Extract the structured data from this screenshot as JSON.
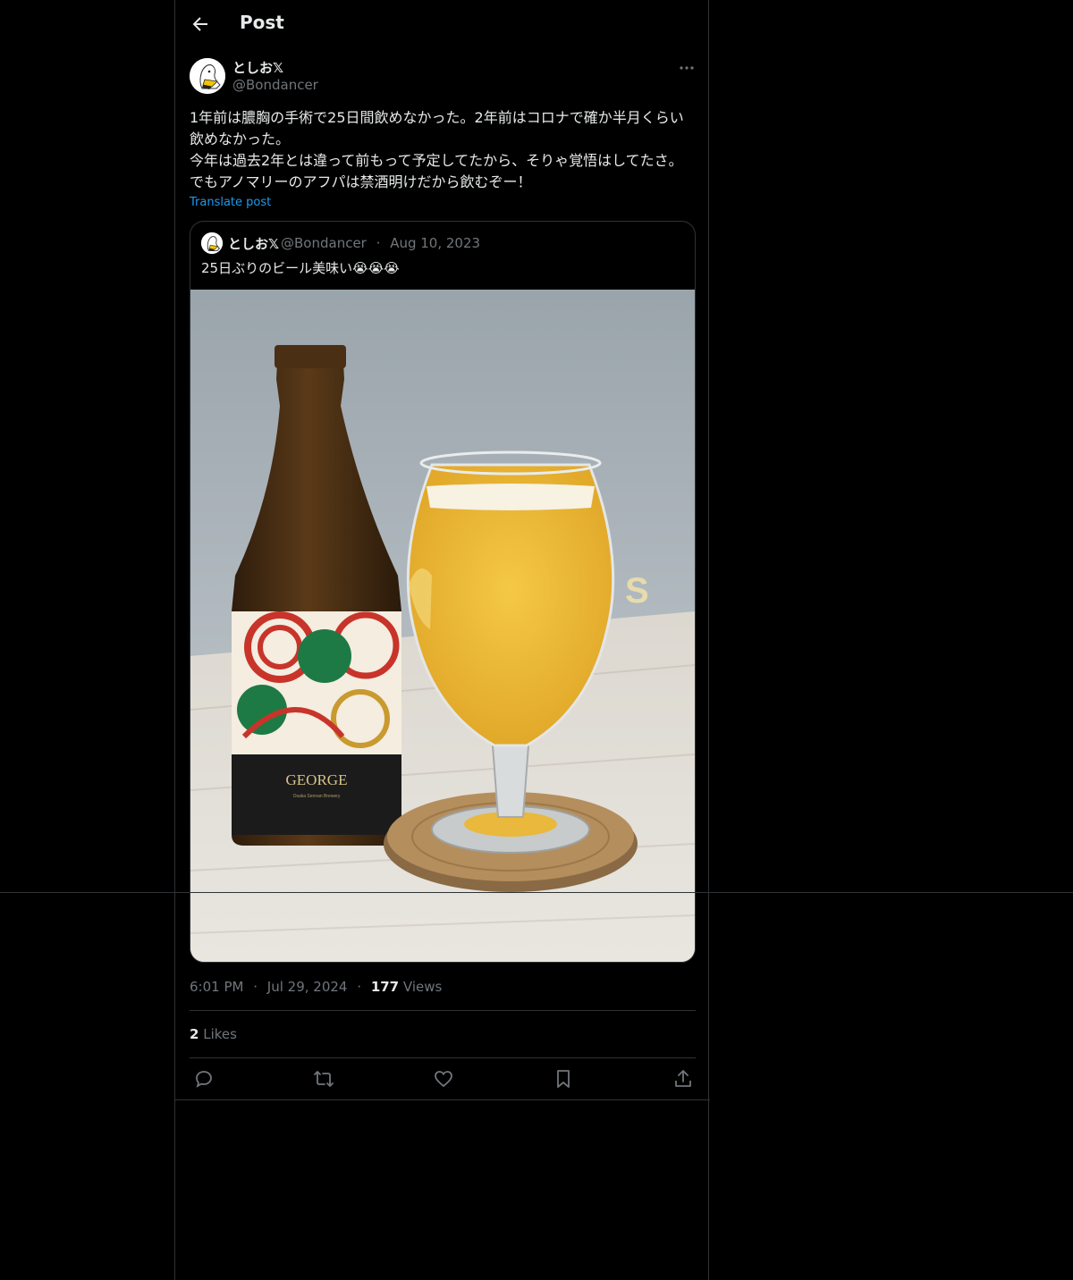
{
  "header": {
    "title": "Post"
  },
  "post": {
    "display_name": "としお𝕏",
    "handle": "@Bondancer",
    "text": "1年前は膿胸の手術で25日間飲めなかった。2年前はコロナで確か半月くらい飲めなかった。\n今年は過去2年とは違って前もって予定してたから、そりゃ覚悟はしてたさ。でもアノマリーのアフパは禁酒明けだから飲むぞー！",
    "translate_label": "Translate post",
    "time": "6:01 PM",
    "date": "Jul 29, 2024",
    "views_count": "177",
    "views_label": "Views",
    "likes_count": "2",
    "likes_label": "Likes",
    "separator": "·"
  },
  "quote": {
    "display_name": "としお𝕏",
    "handle": "@Bondancer",
    "date": "Aug 10, 2023",
    "separator": "·",
    "text": "25日ぶりのビール美味い😭😭😭",
    "photo": {
      "bottle_label_text": "GEORGE",
      "bottle_sub_text": "Osaka Sennan Brewery"
    }
  },
  "actions": [
    "reply-icon",
    "repost-icon",
    "like-icon",
    "bookmark-icon",
    "share-icon"
  ],
  "colors": {
    "accent": "#1d9bf0",
    "muted": "#71767b",
    "text": "#e7e9ea",
    "border": "#2f3336"
  }
}
